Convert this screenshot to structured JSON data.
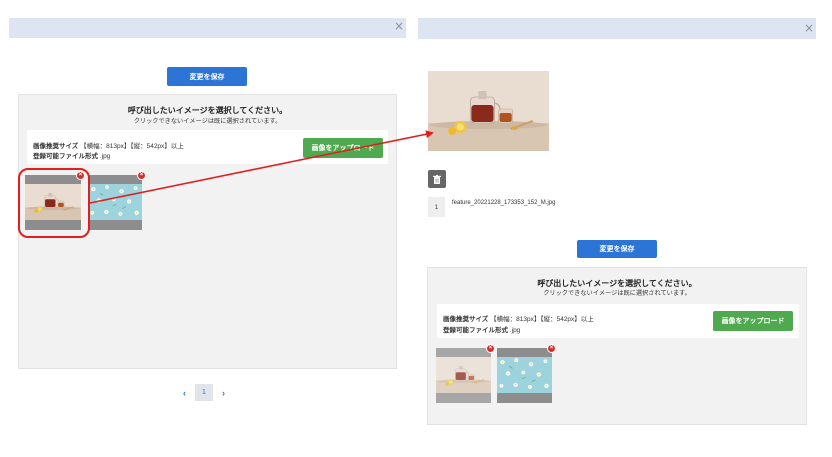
{
  "left_dialog": {
    "close_label": "×",
    "save_button": "変更を保存",
    "selection": {
      "title": "呼び出したいイメージを選択してください。",
      "subtitle": "クリックできないイメージは既に選択されています。",
      "recommended_size_label": "画像推奨サイズ",
      "recommended_size_value": "【横幅：813px】【縦：542px】以上",
      "file_format_label": "登録可能ファイル形式",
      "file_format_value": ".jpg",
      "upload_button": "画像をアップロード"
    },
    "thumbnails": [
      {
        "name": "tea-thumbnail",
        "delete_label": "×"
      },
      {
        "name": "flowers-thumbnail",
        "delete_label": "×"
      }
    ],
    "pagination": {
      "prev": "‹",
      "current_page": "1",
      "next": "›"
    }
  },
  "right_dialog": {
    "close_label": "×",
    "file_number": "1",
    "file_name": "feature_20221228_173353_152_M.jpg",
    "save_button": "変更を保存",
    "selection": {
      "title": "呼び出したいイメージを選択してください。",
      "subtitle": "クリックできないイメージは既に選択されています。",
      "recommended_size_label": "画像推奨サイズ",
      "recommended_size_value": "【横幅：813px】【縦：542px】以上",
      "file_format_label": "登録可能ファイル形式",
      "file_format_value": ".jpg",
      "upload_button": "画像をアップロード"
    },
    "thumbnails": [
      {
        "name": "tea-thumbnail",
        "delete_label": "×"
      },
      {
        "name": "flowers-thumbnail",
        "delete_label": "×"
      }
    ]
  },
  "colors": {
    "titlebar": "#dde5f2",
    "primary_button": "#2c74d6",
    "upload_button": "#4fa94e",
    "highlight": "#e02020",
    "delete_badge": "#d32f2f"
  },
  "icons": {
    "close": "close-icon",
    "delete": "delete-badge-icon",
    "trash": "trash-icon",
    "prev": "chevron-left-icon",
    "next": "chevron-right-icon"
  }
}
